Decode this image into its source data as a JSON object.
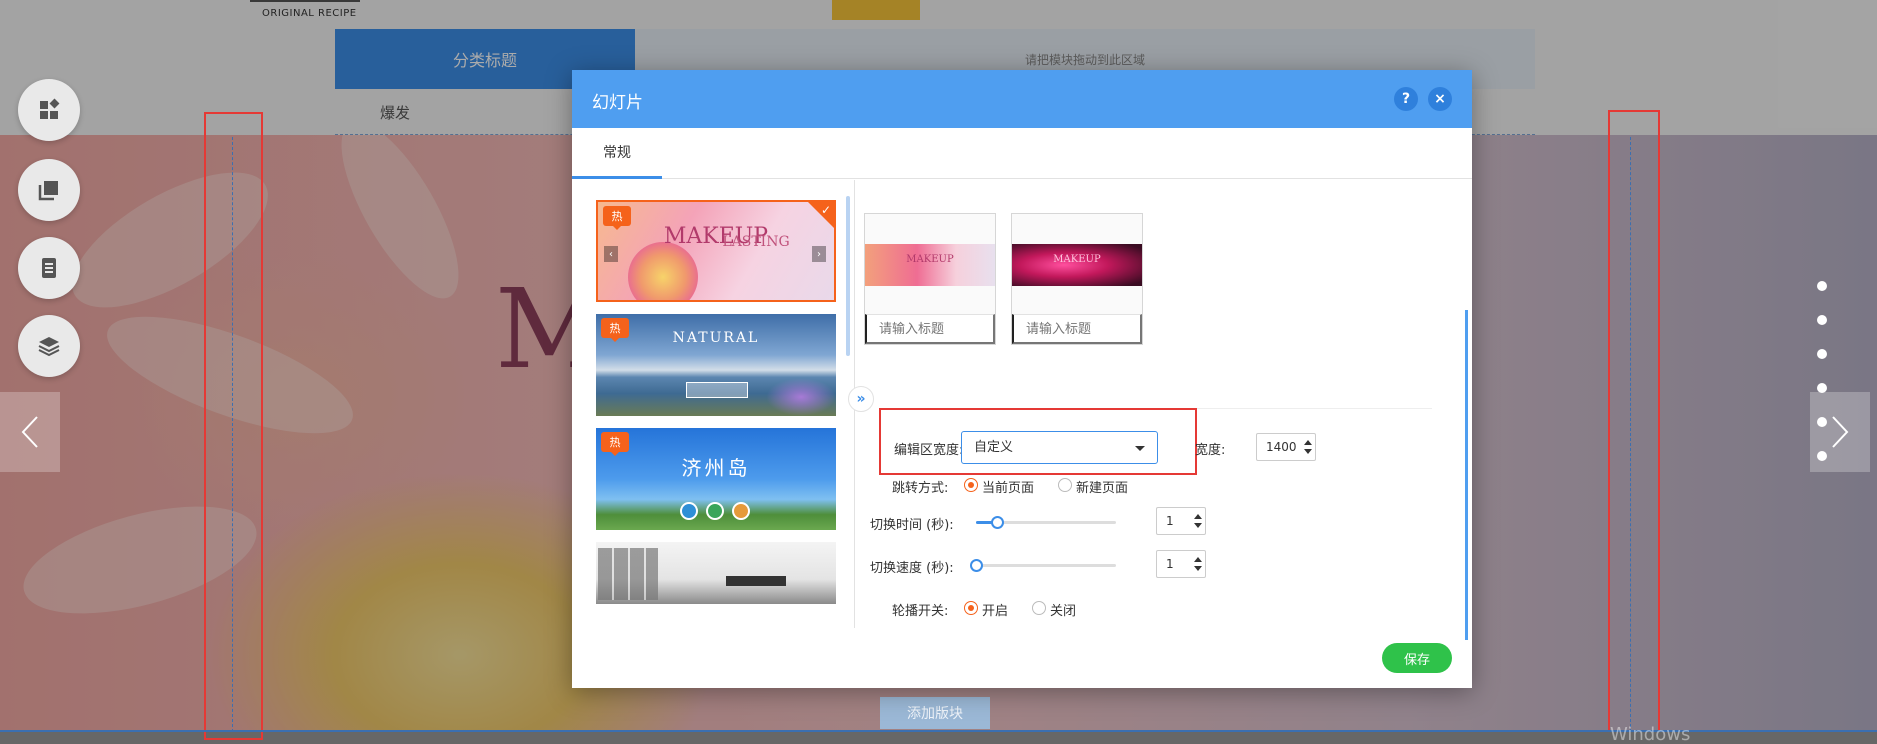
{
  "background": {
    "logo_text": "ORIGINAL RECIPE",
    "category_tab": "分类标题",
    "drop_zone_text": "请把模块拖动到此区域",
    "sub_item": "爆发",
    "hero_letter": "M",
    "add_block_label": "添加版块",
    "windows_ghost": "Windows",
    "tool_buttons": [
      "apps-icon",
      "copy-icon",
      "document-icon",
      "layers-icon"
    ],
    "pager_dots": 6
  },
  "modal": {
    "title": "幻灯片",
    "help_label": "?",
    "close_label": "×",
    "tab_general": "常规",
    "templates": [
      {
        "hot": "热",
        "title": "MAKEUP",
        "subtitle": "LASTING",
        "selected": true
      },
      {
        "hot": "热",
        "title": "NATURAL",
        "selected": false
      },
      {
        "hot": "热",
        "title": "济州岛",
        "selected": false
      },
      {
        "selected": false
      }
    ],
    "slides": [
      {
        "caption": "MAKEUP",
        "placeholder": "请输入标题"
      },
      {
        "caption": "MAKEUP",
        "placeholder": "请输入标题"
      }
    ],
    "form": {
      "edit_width_label": "编辑区宽度:",
      "edit_width_value": "自定义",
      "width_label": "宽度:",
      "width_value": "1400",
      "jump_label": "跳转方式:",
      "jump_options": [
        "当前页面",
        "新建页面"
      ],
      "jump_selected": "当前页面",
      "switch_time_label": "切换时间 (秒):",
      "switch_time_value": "1",
      "switch_time_fill": 0.15,
      "switch_speed_label": "切换速度 (秒):",
      "switch_speed_value": "1",
      "switch_speed_fill": 0.0,
      "autoplay_label": "轮播开关:",
      "autoplay_options": [
        "开启",
        "关闭"
      ],
      "autoplay_selected": "开启"
    },
    "save_label": "保存"
  },
  "colors": {
    "accent_blue": "#4f9ef0",
    "hot_orange": "#f5621b",
    "save_green": "#2fc24a",
    "highlight_red": "#e53935"
  }
}
